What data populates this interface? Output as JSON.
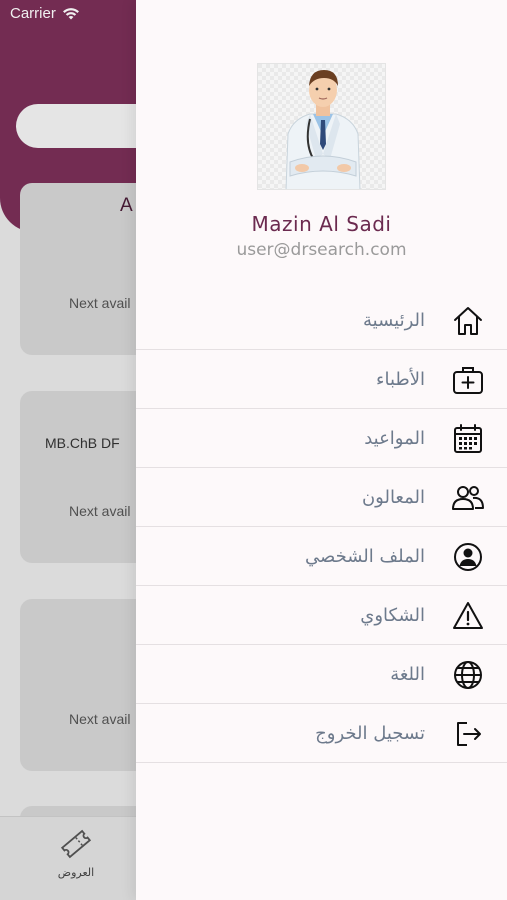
{
  "status_bar": {
    "carrier": "Carrier"
  },
  "background": {
    "cards": [
      {
        "title": "A",
        "next_available": "Next avail"
      },
      {
        "degree": "MB.ChB DF",
        "next_available": "Next avail"
      },
      {
        "next_available": "Next avail"
      }
    ],
    "tabbar": {
      "offers_label": "العروض"
    }
  },
  "drawer": {
    "profile": {
      "name": "Mazin Al Sadi",
      "email": "user@drsearch.com",
      "avatar_icon": "doctor-avatar"
    },
    "menu": [
      {
        "label": "الرئيسية",
        "icon": "home-icon"
      },
      {
        "label": "الأطباء",
        "icon": "medical-kit-icon"
      },
      {
        "label": "المواعيد",
        "icon": "calendar-icon"
      },
      {
        "label": "المعالون",
        "icon": "people-icon"
      },
      {
        "label": "الملف الشخصي",
        "icon": "user-circle-icon"
      },
      {
        "label": "الشكاوي",
        "icon": "warning-icon"
      },
      {
        "label": "اللغة",
        "icon": "globe-icon"
      },
      {
        "label": "تسجيل الخروج",
        "icon": "logout-icon"
      }
    ]
  },
  "colors": {
    "brand": "#7b2f58",
    "name_text": "#6b2a4f",
    "menu_text": "#6d7a8c",
    "drawer_bg": "#fdf9fa"
  }
}
